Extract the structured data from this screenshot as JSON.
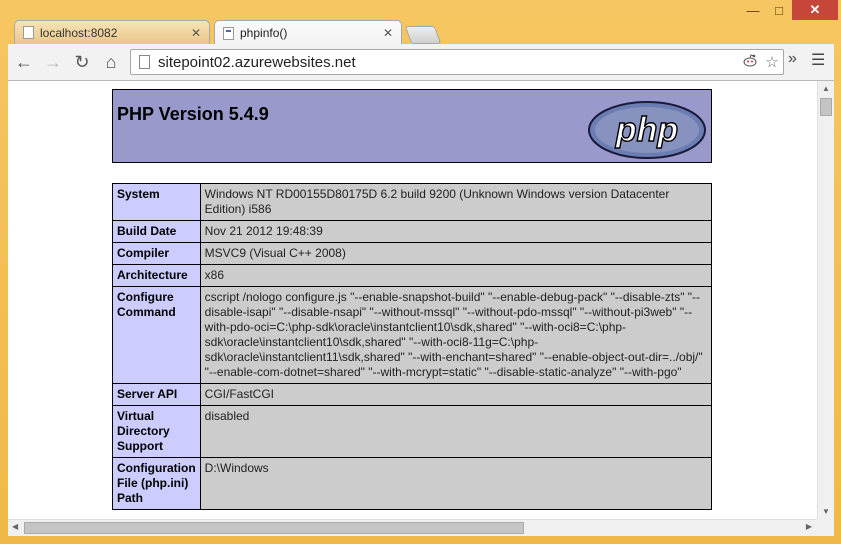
{
  "window": {
    "controls": {
      "minimize": "—",
      "maximize": "□",
      "close": "✕"
    }
  },
  "tabs": [
    {
      "label": "localhost:8082",
      "close": "✕",
      "active": false
    },
    {
      "label": "phpinfo()",
      "close": "✕",
      "active": true
    }
  ],
  "toolbar": {
    "back": "←",
    "forward": "→",
    "reload": "↻",
    "home": "⌂",
    "url": "sitepoint02.azurewebsites.net",
    "extension_icon": "reddit-icon",
    "star": "☆",
    "overflow": "»",
    "menu": "☰"
  },
  "page": {
    "header_title": "PHP Version 5.4.9",
    "logo_text": "php",
    "rows": [
      {
        "key": "System",
        "value": "Windows NT RD00155D80175D 6.2 build 9200 (Unknown Windows version Datacenter Edition) i586"
      },
      {
        "key": "Build Date",
        "value": "Nov 21 2012 19:48:39"
      },
      {
        "key": "Compiler",
        "value": "MSVC9 (Visual C++ 2008)"
      },
      {
        "key": "Architecture",
        "value": "x86"
      },
      {
        "key": "Configure Command",
        "value": "cscript /nologo configure.js \"--enable-snapshot-build\" \"--enable-debug-pack\" \"--disable-zts\" \"--disable-isapi\" \"--disable-nsapi\" \"--without-mssql\" \"--without-pdo-mssql\" \"--without-pi3web\" \"--with-pdo-oci=C:\\php-sdk\\oracle\\instantclient10\\sdk,shared\" \"--with-oci8=C:\\php-sdk\\oracle\\instantclient10\\sdk,shared\" \"--with-oci8-11g=C:\\php-sdk\\oracle\\instantclient11\\sdk,shared\" \"--with-enchant=shared\" \"--enable-object-out-dir=../obj/\" \"--enable-com-dotnet=shared\" \"--with-mcrypt=static\" \"--disable-static-analyze\" \"--with-pgo\""
      },
      {
        "key": "Server API",
        "value": "CGI/FastCGI"
      },
      {
        "key": "Virtual Directory Support",
        "value": "disabled"
      },
      {
        "key": "Configuration File (php.ini) Path",
        "value": "D:\\Windows"
      }
    ]
  },
  "colors": {
    "header_bg": "#9999cc",
    "key_cell_bg": "#ccccff",
    "value_cell_bg": "#cccccc",
    "window_frame": "#f0b848"
  }
}
